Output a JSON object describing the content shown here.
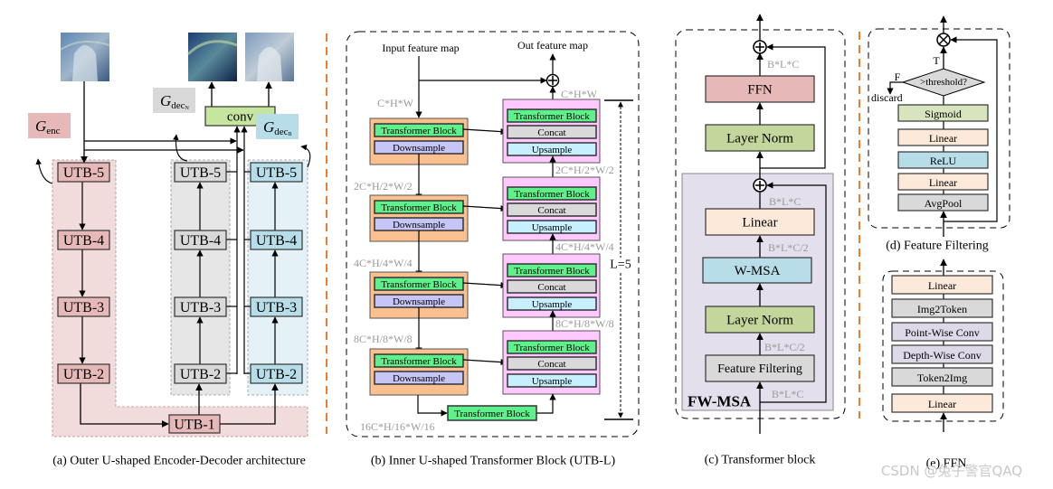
{
  "panel_a": {
    "caption": "(a) Outer U-shaped Encoder-Decoder architecture",
    "conv": "conv",
    "g_enc": {
      "main": "G",
      "sub": "enc"
    },
    "g_dec_n": {
      "main": "G",
      "sub": "dec",
      "subsub": "N"
    },
    "g_dec_b": {
      "main": "G",
      "sub": "dec",
      "subsub": "B"
    },
    "encoder": [
      "UTB-5",
      "UTB-4",
      "UTB-3",
      "UTB-2"
    ],
    "bottleneck": "UTB-1",
    "decoder_n": [
      "UTB-5",
      "UTB-4",
      "UTB-3",
      "UTB-2"
    ],
    "decoder_b": [
      "UTB-5",
      "UTB-4",
      "UTB-3",
      "UTB-2"
    ],
    "colors": {
      "encoder": "#e6b9b8",
      "decoder_n": "#d9d9d9",
      "decoder_b": "#b7dde8",
      "conv": "#c6e6a0"
    }
  },
  "panel_b": {
    "caption": "(b) Inner U-shaped Transformer Block (UTB-L)",
    "input_label": "Input feature map",
    "output_label": "Out feature map",
    "left_dims": [
      "C*H*W",
      "2C*H/2*W/2",
      "4C*H/4*W/4",
      "8C*H/8*W/8",
      "16C*H/16*W/16"
    ],
    "right_dims": [
      "C*H*W",
      "2C*H/2*W/2",
      "4C*H/4*W/4",
      "8C*H/8*W/8"
    ],
    "transformer_block": "Transformer Block",
    "downsample": "Downsample",
    "concat": "Concat",
    "upsample": "Upsample",
    "depth_label": "L=5"
  },
  "panel_c": {
    "caption": "(c) Transformer block",
    "ffn": "FFN",
    "layer_norm": "Layer Norm",
    "linear": "Linear",
    "wmsa": "W-MSA",
    "feature_filtering": "Feature Filtering",
    "region_label": "FW-MSA",
    "dims": [
      "B*L*C",
      "B*L*C",
      "B*L*C/2",
      "B*L*C/2",
      "B*L*C"
    ]
  },
  "panel_d": {
    "caption": "(d) Feature Filtering",
    "decision": ">threshold?",
    "true_label": "T",
    "false_label": "F",
    "discard": "discard",
    "layers": [
      "Sigmoid",
      "Linear",
      "ReLU",
      "Linear",
      "AvgPool"
    ]
  },
  "panel_e": {
    "caption": "(e) FFN",
    "layers": [
      "Linear",
      "Img2Token",
      "Point-Wise Conv",
      "Depth-Wise Conv",
      "Token2Img",
      "Linear"
    ]
  },
  "watermark": "CSDN @兔子警官QAQ"
}
